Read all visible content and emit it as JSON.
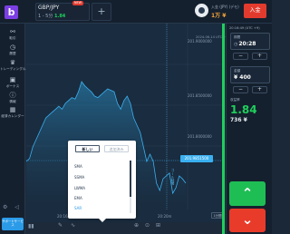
{
  "topbar": {
    "logo": "b",
    "asset_name": "GBP/JPY",
    "asset_timeframe": "1 - 5分",
    "asset_payout": "1.84",
    "add_tab": "+",
    "new_badge": "NEW",
    "account_label": "入金 (JPY) (デモ)",
    "account_balance": "1万 ¥",
    "deposit_label": "入金"
  },
  "sidebar": {
    "items": [
      {
        "icon": "trade-icon",
        "label": "取引"
      },
      {
        "icon": "history-icon",
        "label": "履歴"
      },
      {
        "icon": "tournament-icon",
        "label": "トレーディングルーム"
      },
      {
        "icon": "bonus-icon",
        "label": "ボーナス"
      },
      {
        "icon": "info-icon",
        "label": "情報"
      },
      {
        "icon": "calendar-icon",
        "label": "経済カレンダー"
      }
    ],
    "help_label": "サポートサービス"
  },
  "chart": {
    "date_label": "2024-06-14 UTC +9",
    "y_ticks": [
      "201.9000000",
      "201.8500000",
      "201.8000000"
    ],
    "current_price": "201.9851500",
    "x_ticks": [
      "20:16m",
      "20:20m"
    ],
    "zoom_label": "1分間",
    "goal_label": "ゴール時間"
  },
  "chart_data": {
    "type": "area",
    "title": "",
    "series": [
      {
        "values": [
          0.3,
          0.32,
          0.4,
          0.45,
          0.5,
          0.55,
          0.6,
          0.62,
          0.64,
          0.66,
          0.68,
          0.66,
          0.7,
          0.72,
          0.74,
          0.73,
          0.78,
          0.85,
          0.82,
          0.8,
          0.78,
          0.75,
          0.74,
          0.76,
          0.78,
          0.8,
          0.79,
          0.78,
          0.7,
          0.66,
          0.72,
          0.75,
          0.7,
          0.6,
          0.55,
          0.5,
          0.4,
          0.3,
          0.35,
          0.3,
          0.15,
          0.1,
          0.18,
          0.2,
          0.22,
          0.08,
          0.12,
          0.2,
          0.18,
          0.15
        ]
      }
    ]
  },
  "indicator_popup": {
    "tabs": [
      "新しい",
      "追加済み"
    ],
    "items": [
      "SMA",
      "SSMA",
      "LWMA",
      "EMA",
      "SAR"
    ],
    "selected": "SAR"
  },
  "trade_panel": {
    "time_label": "20:16:49 (UTC +9)",
    "expiry_caption": "期間",
    "expiry_value": "20:28",
    "amount_caption": "金額",
    "amount_value": "¥ 400",
    "minus_label": "−",
    "plus_label": "+",
    "payout_caption": "収益率",
    "payout_value": "1.84",
    "payout_amount": "736 ¥"
  },
  "colors": {
    "up": "#1fbe55",
    "down": "#e83b2a",
    "accent": "#2b9be8",
    "price_line": "#3ab0f0"
  }
}
